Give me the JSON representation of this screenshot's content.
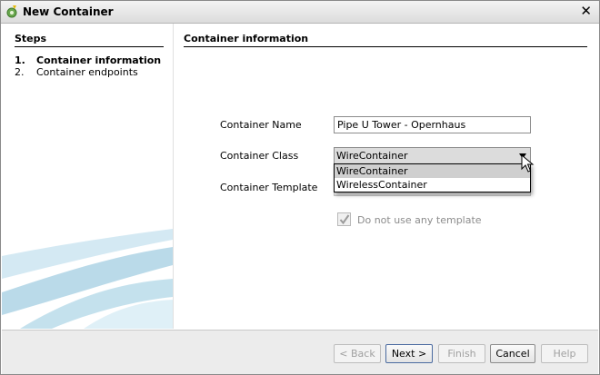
{
  "window": {
    "title": "New Container",
    "close_glyph": "✕"
  },
  "steps": {
    "heading": "Steps",
    "items": [
      {
        "num": "1.",
        "label": "Container information",
        "active": true
      },
      {
        "num": "2.",
        "label": "Container endpoints",
        "active": false
      }
    ]
  },
  "content": {
    "heading": "Container information",
    "name_label": "Container Name",
    "name_value": "Pipe U Tower - Opernhaus",
    "class_label": "Container Class",
    "class_value": "WireContainer",
    "class_options": [
      "WireContainer",
      "WirelessContainer"
    ],
    "template_label": "Container Template",
    "template_value": "",
    "no_template_label": "Do not use any template",
    "no_template_checked": true
  },
  "buttons": {
    "back": "< Back",
    "next": "Next >",
    "finish": "Finish",
    "cancel": "Cancel",
    "help": "Help"
  },
  "icons": {
    "app": "green-gear-icon",
    "close": "close-icon",
    "dropdown": "chevron-down-icon",
    "check": "checkmark-icon",
    "cursor": "mouse-pointer-icon"
  },
  "colors": {
    "selected_option": "#cfcfcf",
    "art_blue": "#9ccbe0"
  }
}
